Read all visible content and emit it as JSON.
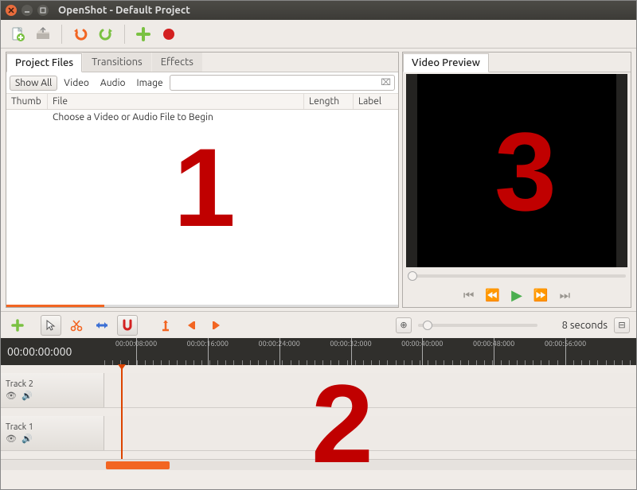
{
  "window": {
    "title": "OpenShot - Default Project"
  },
  "toolbar": {
    "new_file": "new-file",
    "open_file": "open-file",
    "undo": "undo",
    "redo": "redo",
    "add": "add",
    "record": "record"
  },
  "left": {
    "tabs": [
      "Project Files",
      "Transitions",
      "Effects"
    ],
    "active_tab": 0,
    "filters": {
      "show_all": "Show All",
      "video": "Video",
      "audio": "Audio",
      "image": "Image"
    },
    "columns": {
      "thumb": "Thumb",
      "file": "File",
      "length": "Length",
      "label": "Label"
    },
    "empty_row": "Choose a Video or Audio File to Begin"
  },
  "right": {
    "tab": "Video Preview"
  },
  "timeline_toolbar": {
    "zoom_label": "8 seconds"
  },
  "ruler": {
    "position": "00:00:00:000",
    "major_ticks": [
      "00:00:08:000",
      "00:00:16:000",
      "00:00:24:000",
      "00:00:32:000",
      "00:00:40:000",
      "00:00:48:000",
      "00:00:56:000"
    ]
  },
  "tracks": [
    {
      "name": "Track 2"
    },
    {
      "name": "Track 1"
    }
  ],
  "overlays": {
    "one": "1",
    "two": "2",
    "three": "3"
  }
}
